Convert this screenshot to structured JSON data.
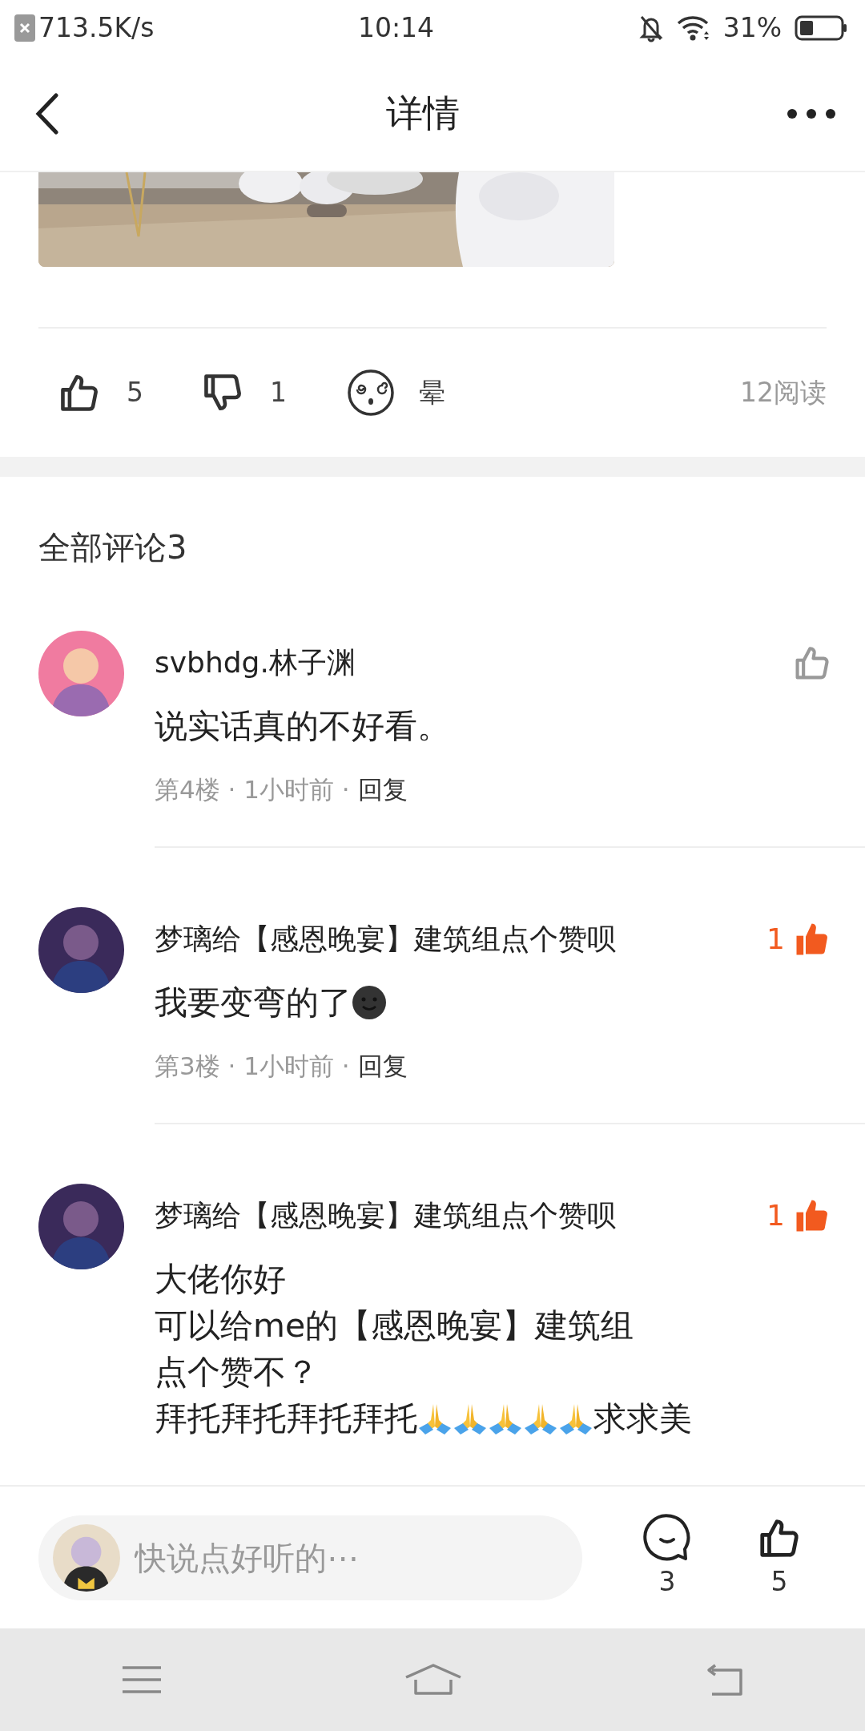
{
  "status_bar": {
    "net_speed": "713.5K/s",
    "time": "10:14",
    "battery": "31%"
  },
  "header": {
    "title": "详情"
  },
  "post": {
    "reactions": [
      {
        "kind": "like",
        "count": "5"
      },
      {
        "kind": "dislike",
        "count": "1"
      },
      {
        "kind": "dizzy",
        "label": "晕"
      }
    ],
    "views": "12阅读"
  },
  "comments_heading": "全部评论3",
  "comments": [
    {
      "author": "svbhdg.林子渊",
      "liked": false,
      "body": [
        [
          {
            "kind": "text",
            "text": "说实话真的不好看。"
          }
        ]
      ],
      "meta": "第4楼 · 1小时前 ·",
      "reply": "回复"
    },
    {
      "author": "梦璃给【感恩晚宴】建筑组点个赞呗",
      "liked": true,
      "likes": "1",
      "body": [
        [
          {
            "kind": "text",
            "text": "我要变弯的了"
          },
          {
            "kind": "smiley"
          }
        ]
      ],
      "meta": "第3楼 · 1小时前 ·",
      "reply": "回复"
    },
    {
      "author": "梦璃给【感恩晚宴】建筑组点个赞呗",
      "liked": true,
      "likes": "1",
      "body": [
        [
          {
            "kind": "text",
            "text": "大佬你好"
          }
        ],
        [
          {
            "kind": "text",
            "text": "可以给me的【感恩晚宴】建筑组"
          }
        ],
        [
          {
            "kind": "text",
            "text": "点个赞不？"
          }
        ],
        [
          {
            "kind": "text",
            "text": "拜托拜托拜托拜托"
          },
          {
            "kind": "pray"
          },
          {
            "kind": "pray"
          },
          {
            "kind": "pray"
          },
          {
            "kind": "pray"
          },
          {
            "kind": "pray"
          },
          {
            "kind": "text",
            "text": "求求美"
          }
        ]
      ]
    }
  ],
  "bottom_bar": {
    "placeholder": "快说点好听的⋯",
    "comment_count": "3",
    "like_count": "5"
  }
}
